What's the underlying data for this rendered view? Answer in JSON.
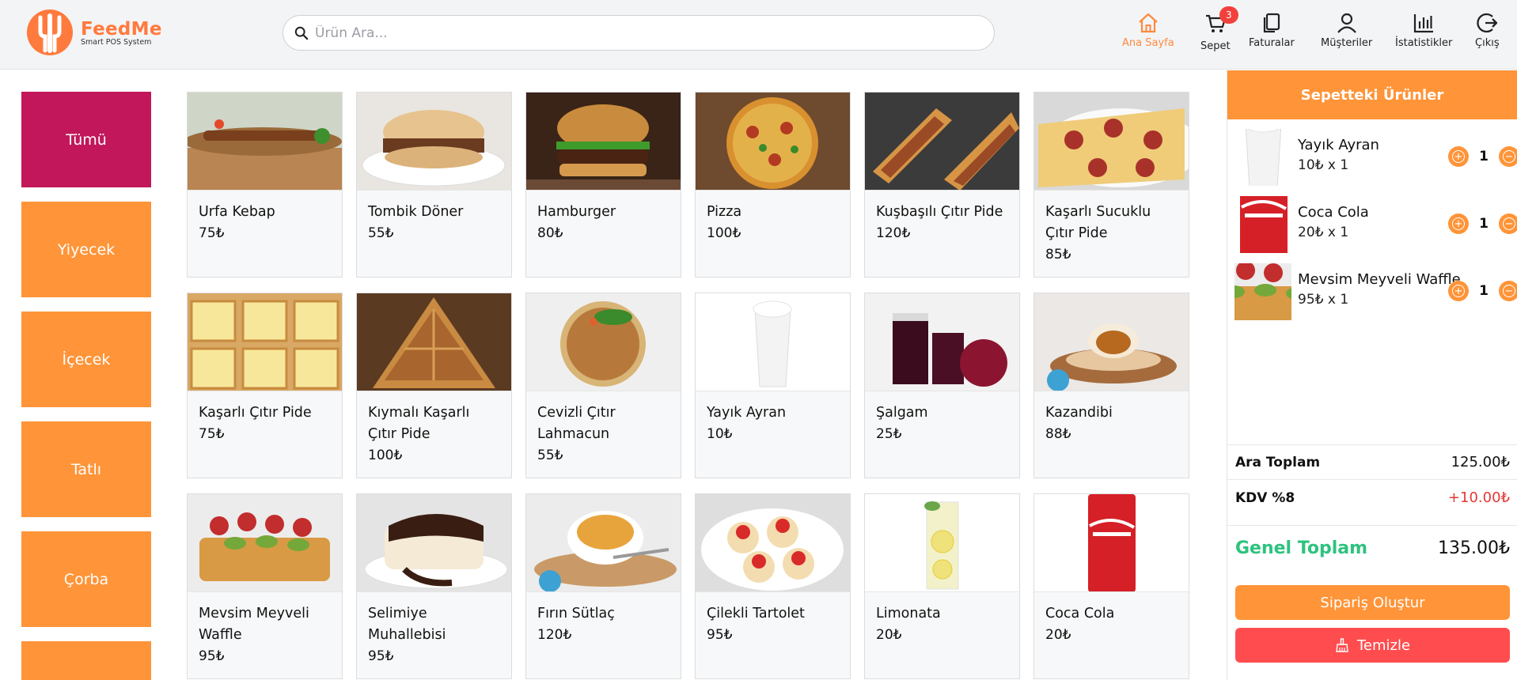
{
  "brand": {
    "name": "FeedMe",
    "tagline": "Smart POS System",
    "accent": "#ff8a3d"
  },
  "search": {
    "placeholder": "Ürün Ara..."
  },
  "nav": [
    {
      "label": "Ana Sayfa",
      "icon": "home-icon",
      "active": true
    },
    {
      "label": "Sepet",
      "icon": "cart-icon",
      "badge": "3"
    },
    {
      "label": "Faturalar",
      "icon": "invoice-icon"
    },
    {
      "label": "Müşteriler",
      "icon": "user-icon"
    },
    {
      "label": "İstatistikler",
      "icon": "chart-icon"
    },
    {
      "label": "Çıkış",
      "icon": "logout-icon"
    }
  ],
  "categories": [
    {
      "label": "Tümü",
      "active": true
    },
    {
      "label": "Yiyecek"
    },
    {
      "label": "İçecek"
    },
    {
      "label": "Tatlı"
    },
    {
      "label": "Çorba"
    },
    {
      "label": ""
    }
  ],
  "products": [
    {
      "name": "Urfa Kebap",
      "price": "75₺",
      "image": "kebab"
    },
    {
      "name": "Tombik Döner",
      "price": "55₺",
      "image": "doner"
    },
    {
      "name": "Hamburger",
      "price": "80₺",
      "image": "burger"
    },
    {
      "name": "Pizza",
      "price": "100₺",
      "image": "pizza"
    },
    {
      "name": "Kuşbaşılı Çıtır Pide",
      "price": "120₺",
      "image": "pide-meat"
    },
    {
      "name": "Kaşarlı Sucuklu Çıtır Pide",
      "price": "85₺",
      "image": "pide-sucuk"
    },
    {
      "name": "Kaşarlı Çıtır Pide",
      "price": "75₺",
      "image": "pide-cheese"
    },
    {
      "name": "Kıymalı Kaşarlı Çıtır Pide",
      "price": "100₺",
      "image": "pide-mince"
    },
    {
      "name": "Cevizli Çıtır Lahmacun",
      "price": "55₺",
      "image": "lahmacun"
    },
    {
      "name": "Yayık Ayran",
      "price": "10₺",
      "image": "ayran"
    },
    {
      "name": "Şalgam",
      "price": "25₺",
      "image": "salgam"
    },
    {
      "name": "Kazandibi",
      "price": "88₺",
      "image": "kazandibi"
    },
    {
      "name": "Mevsim Meyveli Waffle",
      "price": "95₺",
      "image": "waffle"
    },
    {
      "name": "Selimiye Muhallebisi",
      "price": "95₺",
      "image": "muhallebi"
    },
    {
      "name": "Fırın Sütlaç",
      "price": "120₺",
      "image": "sutlac"
    },
    {
      "name": "Çilekli Tartolet",
      "price": "95₺",
      "image": "tartolet"
    },
    {
      "name": "Limonata",
      "price": "20₺",
      "image": "limonata"
    },
    {
      "name": "Coca Cola",
      "price": "20₺",
      "image": "cola"
    }
  ],
  "cart": {
    "title": "Sepetteki Ürünler",
    "items": [
      {
        "name": "Yayık Ayran",
        "qty_price": "10₺ x 1",
        "qty": "1",
        "image": "ayran"
      },
      {
        "name": "Coca Cola",
        "qty_price": "20₺ x 1",
        "qty": "1",
        "image": "cola"
      },
      {
        "name": "Mevsim Meyveli Waffle",
        "qty_price": "95₺ x 1",
        "qty": "1",
        "image": "waffle"
      }
    ],
    "subtotal_label": "Ara Toplam",
    "subtotal_value": "125.00₺",
    "tax_label": "KDV %8",
    "tax_value": "+10.00₺",
    "total_label": "Genel Toplam",
    "total_value": "135.00₺",
    "order_button": "Sipariş Oluştur",
    "clear_button": "Temizle"
  }
}
